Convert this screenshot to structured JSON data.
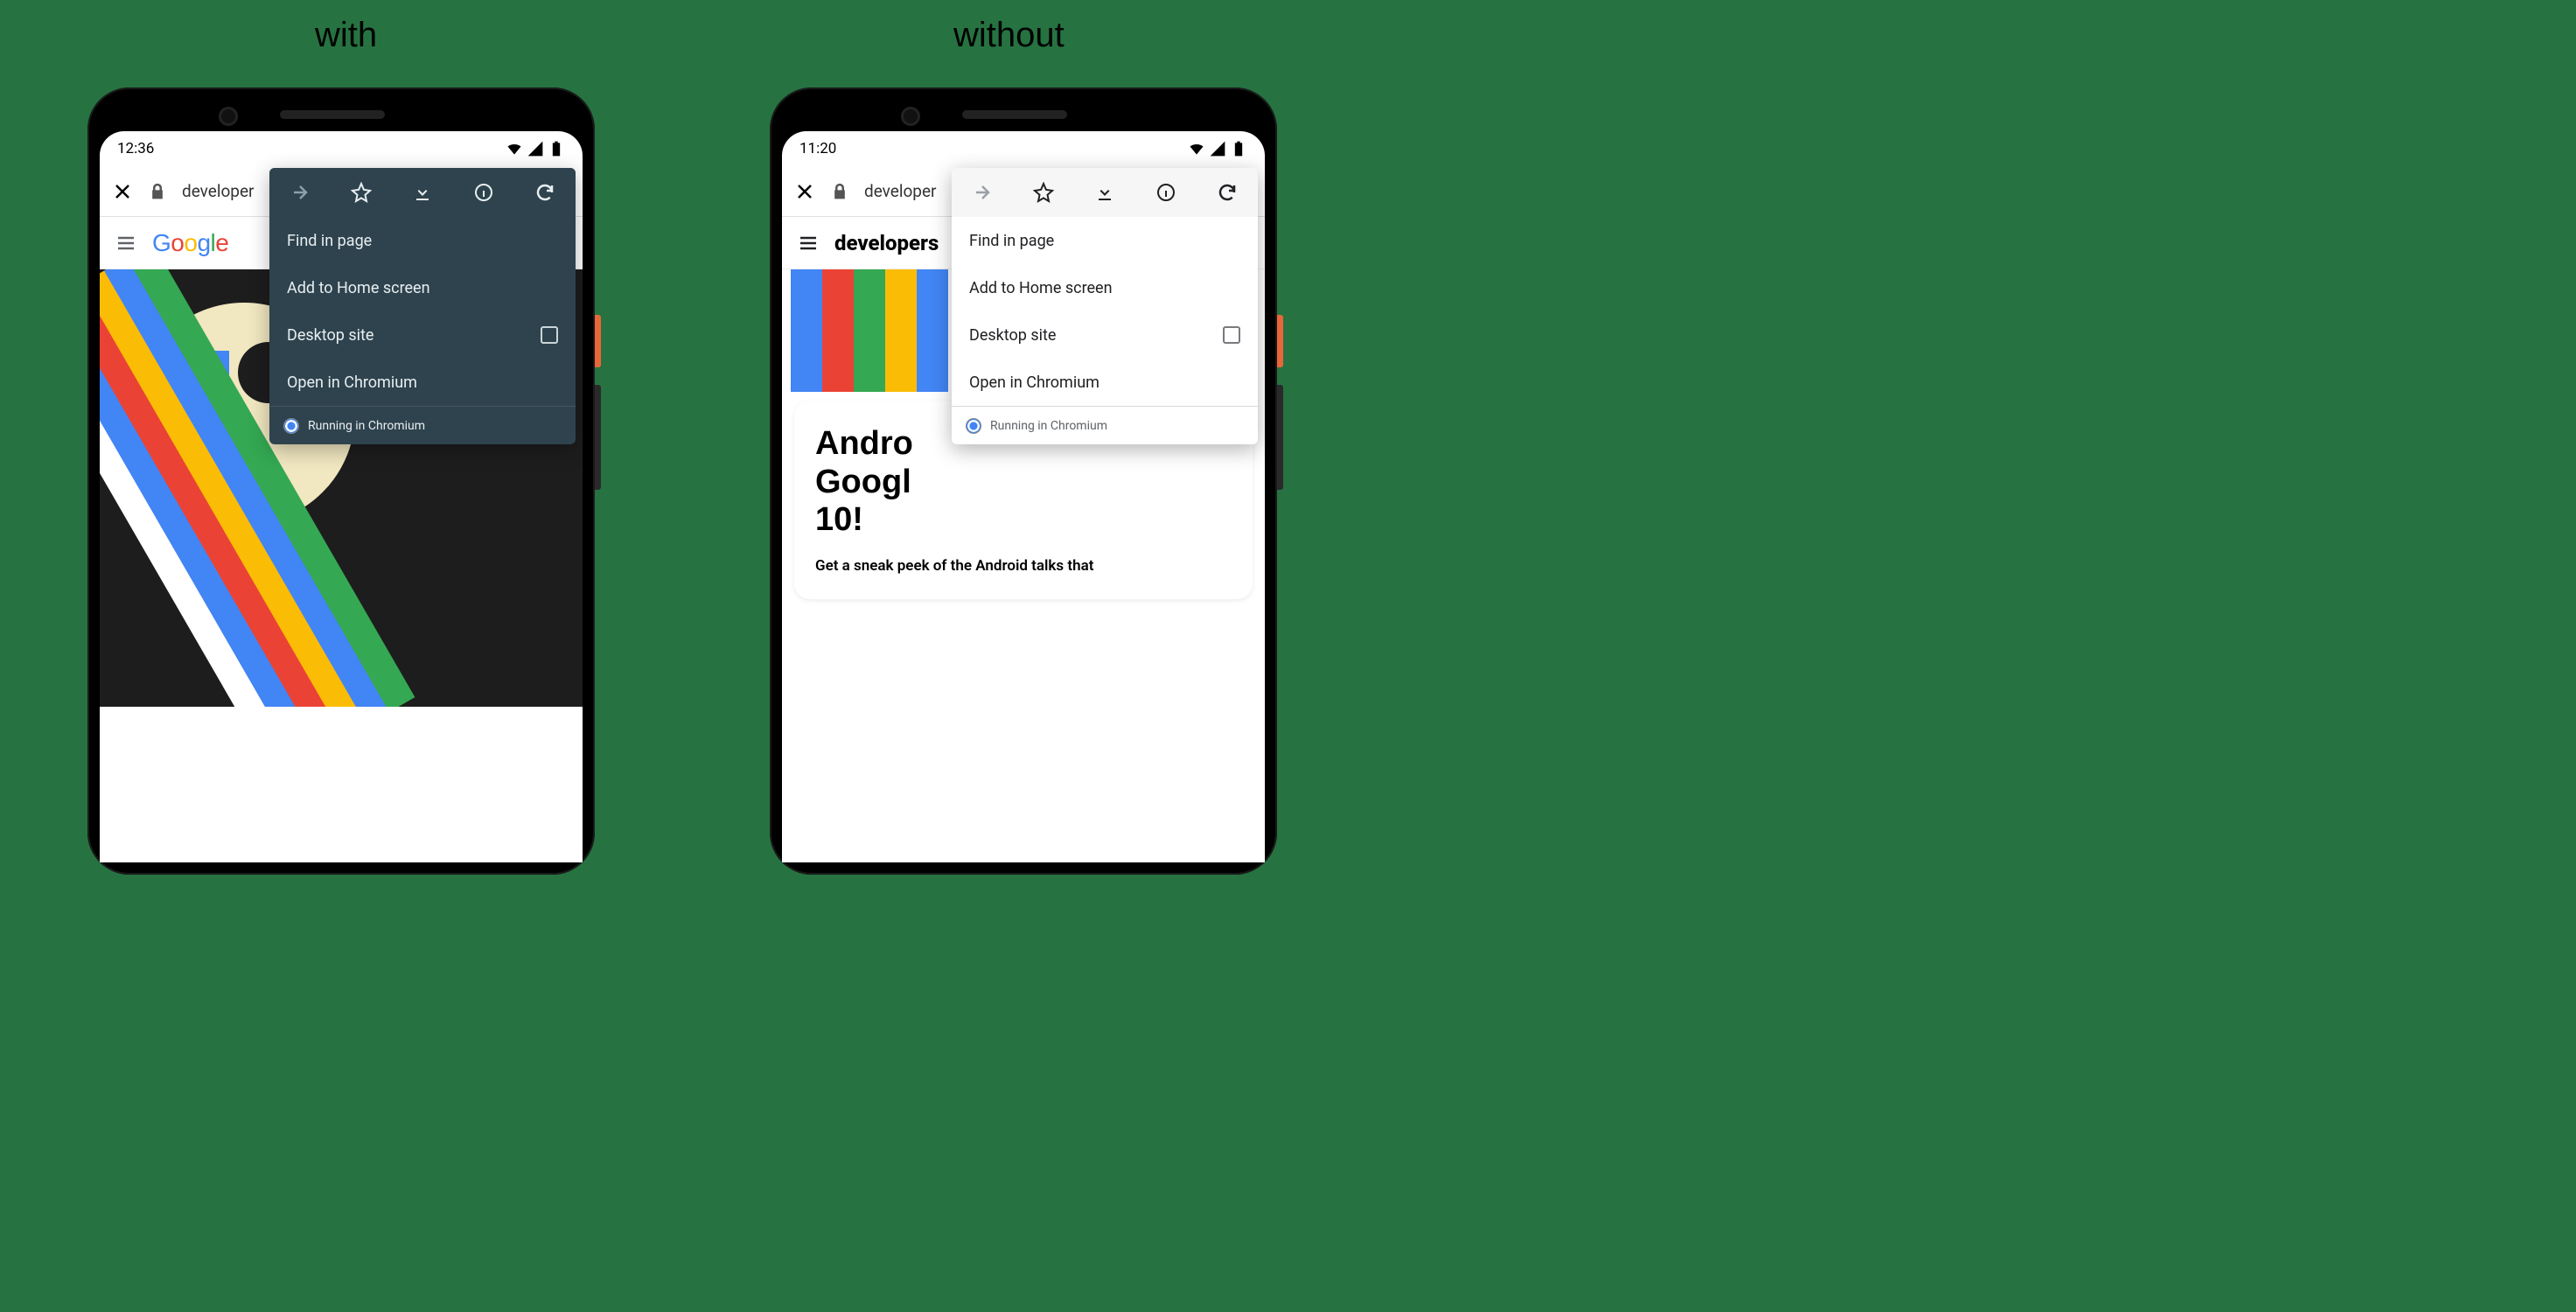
{
  "captions": {
    "with": "with",
    "without": "without"
  },
  "status": {
    "time_left": "12:36",
    "time_right": "11:20"
  },
  "addressbar": {
    "url": "developer"
  },
  "page_header": {
    "brand_text": "developers"
  },
  "card": {
    "title_partial": "Andro\nGoogl\n10!",
    "subtitle_partial": "Get a sneak peek of the Android talks that"
  },
  "menu": {
    "find": "Find in page",
    "add_home": "Add to Home screen",
    "desktop": "Desktop site",
    "open_chromium": "Open in Chromium",
    "running": "Running in Chromium"
  }
}
